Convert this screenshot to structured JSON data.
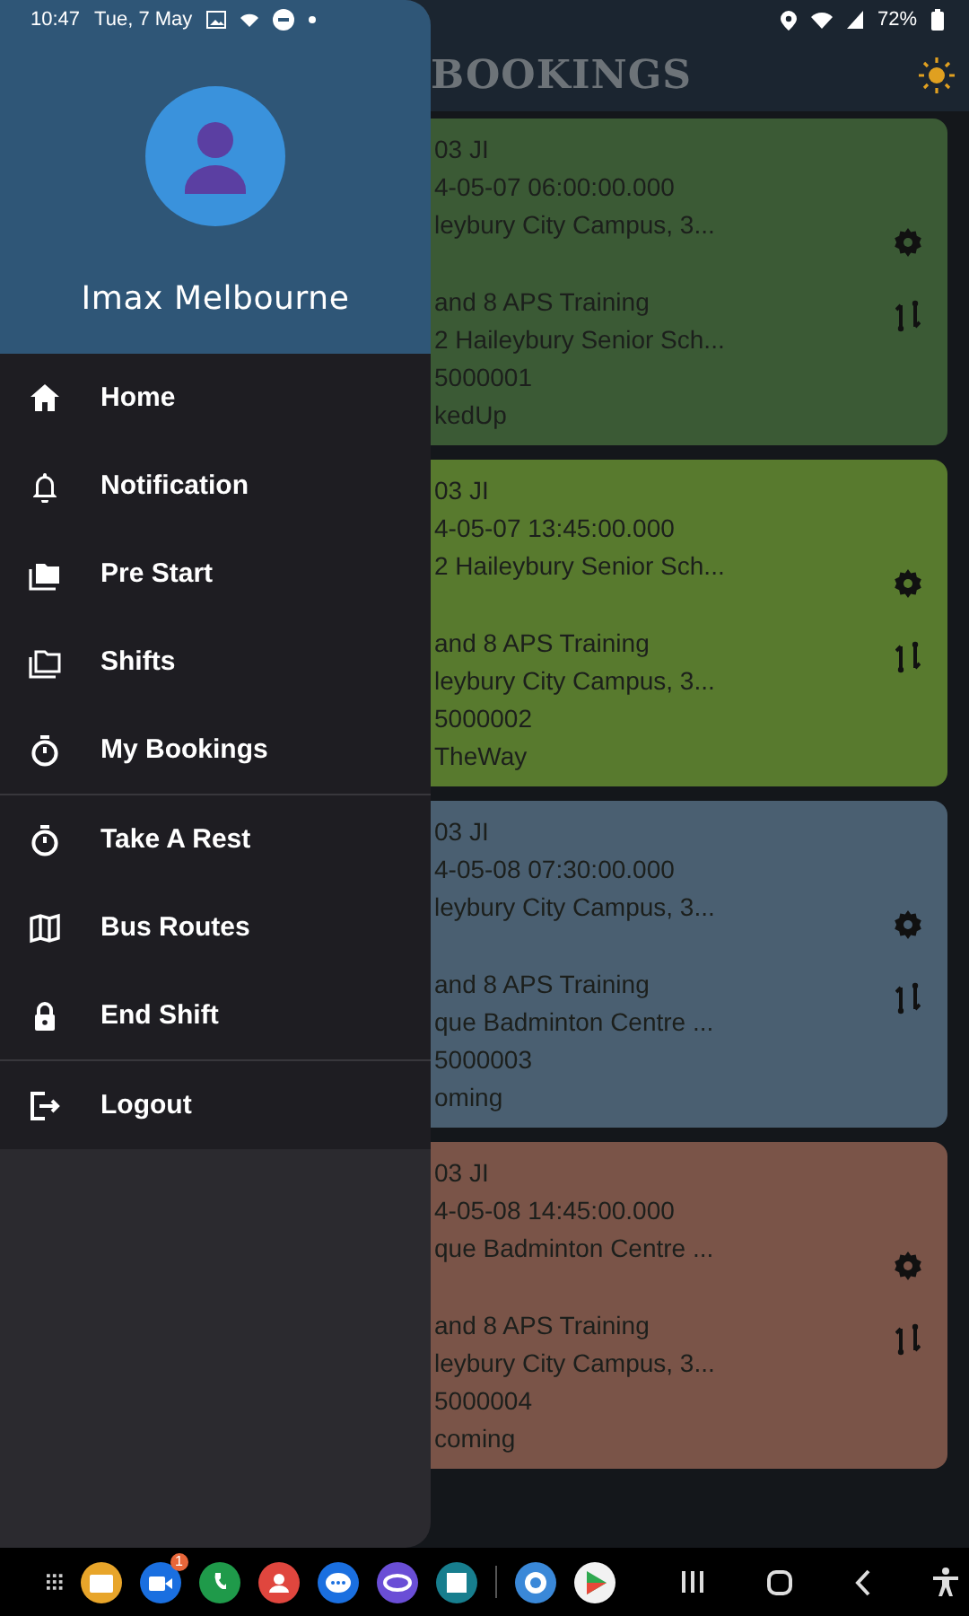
{
  "status_bar": {
    "time": "10:47",
    "date": "Tue, 7 May",
    "battery": "72%"
  },
  "app_bar": {
    "title": "BOOKINGS"
  },
  "drawer": {
    "user_name": "Imax Melbourne",
    "sections": [
      [
        {
          "label": "Home"
        },
        {
          "label": "Notification"
        },
        {
          "label": "Pre Start"
        },
        {
          "label": "Shifts"
        },
        {
          "label": "My Bookings"
        }
      ],
      [
        {
          "label": "Take A Rest"
        },
        {
          "label": "Bus Routes"
        },
        {
          "label": "End Shift"
        }
      ],
      [
        {
          "label": "Logout"
        }
      ]
    ]
  },
  "bookings": [
    {
      "color": "#3b5a35",
      "lines": [
        "03 JI",
        "4-05-07 06:00:00.000",
        "leybury City Campus, 3...",
        "and 8 APS Training",
        "2 Haileybury Senior Sch...",
        "5000001",
        "kedUp"
      ]
    },
    {
      "color": "#587a2e",
      "lines": [
        "03 JI",
        "4-05-07 13:45:00.000",
        "2 Haileybury Senior Sch...",
        "and 8 APS Training",
        "leybury City Campus, 3...",
        "5000002",
        "TheWay"
      ]
    },
    {
      "color": "#4a5f71",
      "lines": [
        "03 JI",
        "4-05-08 07:30:00.000",
        "leybury City Campus, 3...",
        "and 8 APS Training",
        "que Badminton Centre ...",
        "5000003",
        "oming"
      ]
    },
    {
      "color": "#7a5448",
      "lines": [
        "03 JI",
        "4-05-08 14:45:00.000",
        "que Badminton Centre ...",
        "and 8 APS Training",
        "leybury City Campus, 3...",
        "5000004",
        "coming"
      ]
    }
  ],
  "nav_bar": {
    "badge": "1"
  }
}
